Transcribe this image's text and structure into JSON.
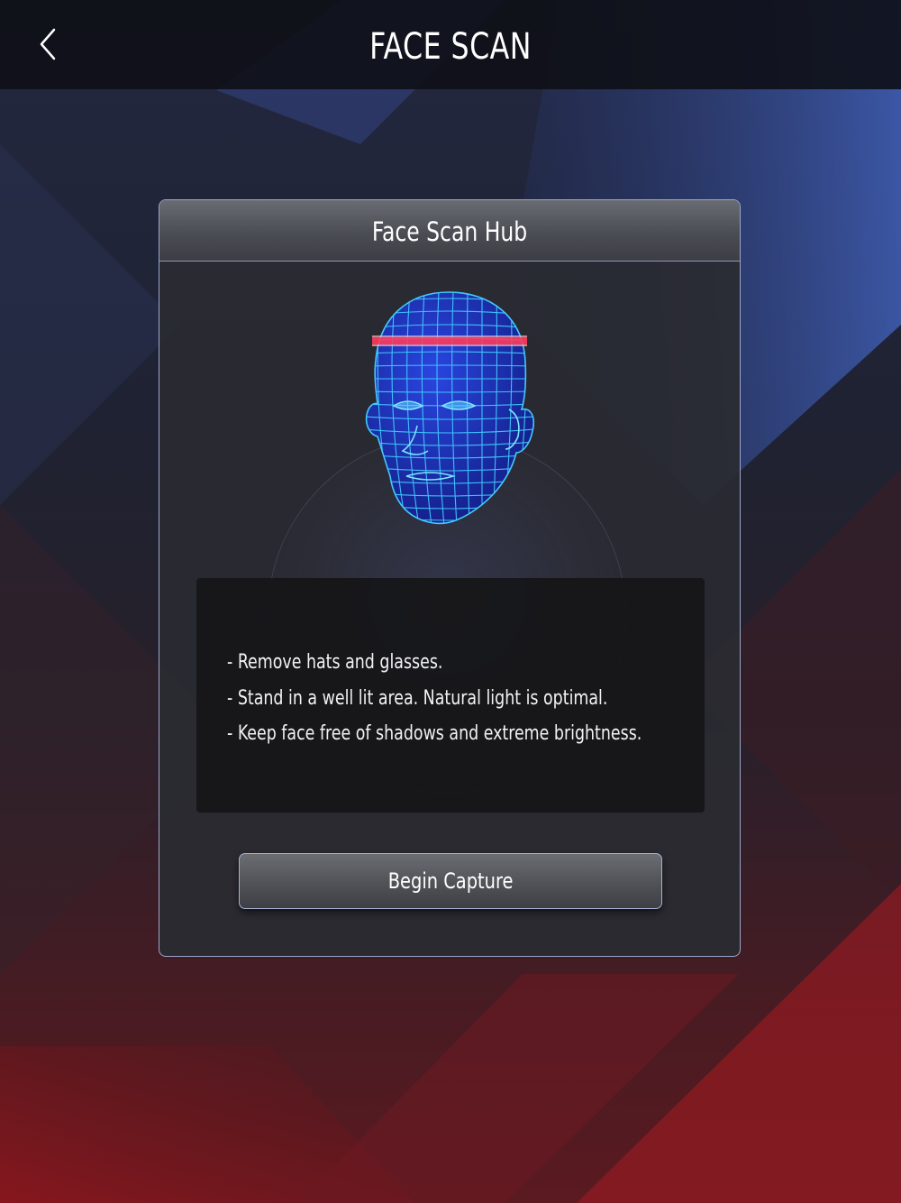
{
  "screen": {
    "title": "FACE SCAN"
  },
  "nav": {
    "back_icon": "chevron-left-icon"
  },
  "hub": {
    "title": "Face Scan Hub",
    "illustration": "face-wireframe-scan",
    "instructions": [
      "- Remove hats and glasses.",
      "- Stand in a well lit area. Natural light is optimal.",
      "- Keep face free of shadows and extreme brightness."
    ],
    "button_label": "Begin Capture"
  },
  "colors": {
    "mesh_fill": "#1a2fb8",
    "mesh_lines": "#43c9ff",
    "scan_line": "#ff3b5c",
    "panel_border": "#9aa6c8",
    "background_blue": "#3a5ec8",
    "background_red": "#a11c24"
  }
}
